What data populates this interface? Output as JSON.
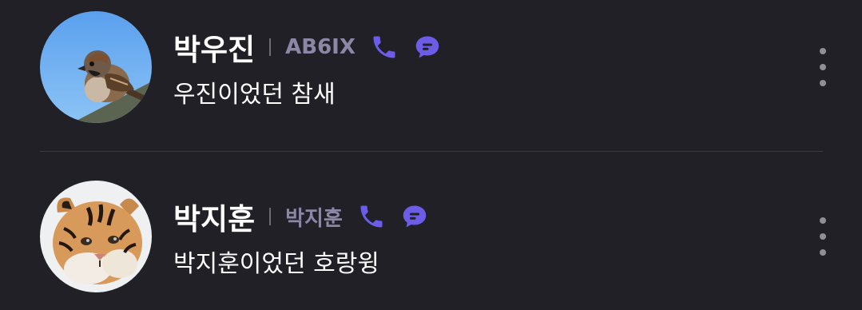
{
  "contacts": [
    {
      "name": "박우진",
      "tag": "AB6IX",
      "status": "우진이었던 참새",
      "avatar_icon": "sparrow-avatar"
    },
    {
      "name": "박지훈",
      "tag": "박지훈",
      "status": "박지훈이었던 호랑윙",
      "avatar_icon": "tiger-avatar"
    }
  ],
  "colors": {
    "background": "#202026",
    "accent": "#6c5ce7",
    "tag_text": "#8c87a6",
    "divider": "#3a3a42"
  },
  "icons": {
    "call": "phone-icon",
    "chat": "chat-bubble-icon",
    "more": "more-vertical-icon"
  }
}
